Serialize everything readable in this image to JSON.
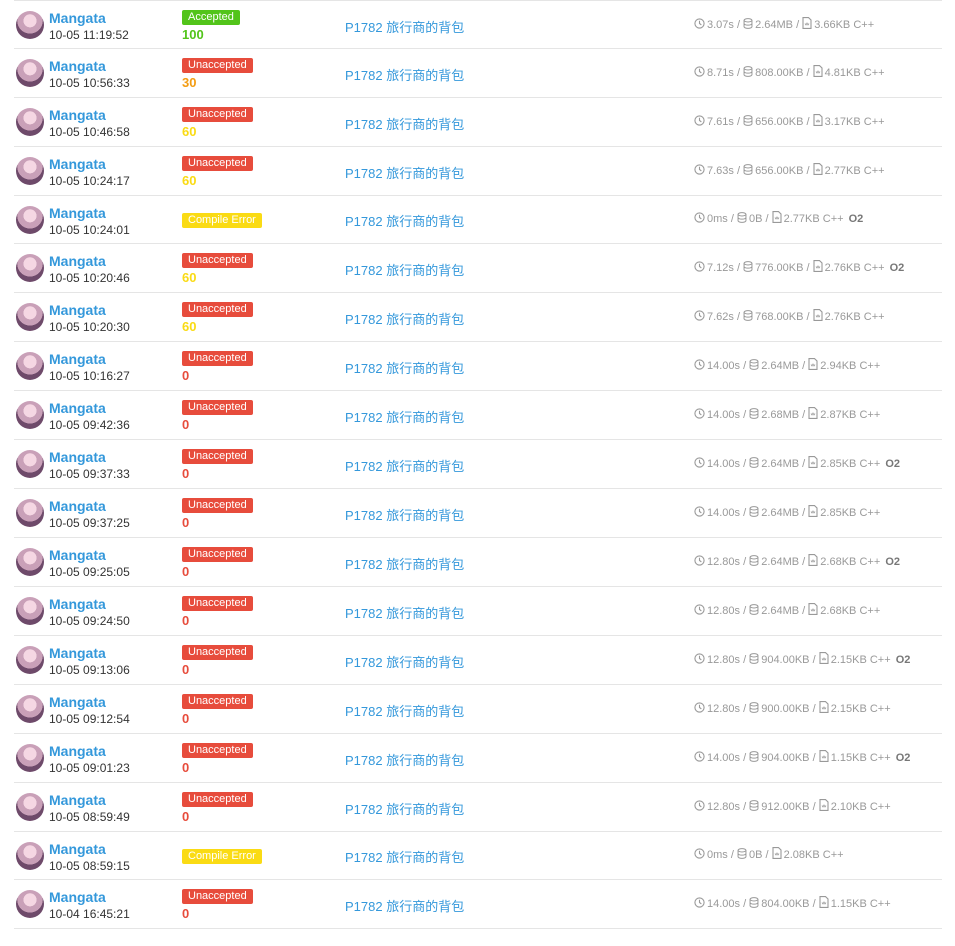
{
  "colors": {
    "accepted": "#52c41a",
    "unaccepted": "#e74c3c",
    "compile_error": "#fadb14",
    "link": "#3498db",
    "score_100": "#52c41a",
    "score_30": "#f39c12",
    "score_60": "#fadb14",
    "score_0": "#e74c3c"
  },
  "records": [
    {
      "user": "Mangata",
      "time": "10-05 11:19:52",
      "status": "Accepted",
      "score": "100",
      "problem": "P1782 旅行商的背包",
      "run_time": "3.07s",
      "memory": "2.64MB",
      "code_size": "3.66KB",
      "lang": "C++",
      "o2": ""
    },
    {
      "user": "Mangata",
      "time": "10-05 10:56:33",
      "status": "Unaccepted",
      "score": "30",
      "problem": "P1782 旅行商的背包",
      "run_time": "8.71s",
      "memory": "808.00KB",
      "code_size": "4.81KB",
      "lang": "C++",
      "o2": ""
    },
    {
      "user": "Mangata",
      "time": "10-05 10:46:58",
      "status": "Unaccepted",
      "score": "60",
      "problem": "P1782 旅行商的背包",
      "run_time": "7.61s",
      "memory": "656.00KB",
      "code_size": "3.17KB",
      "lang": "C++",
      "o2": ""
    },
    {
      "user": "Mangata",
      "time": "10-05 10:24:17",
      "status": "Unaccepted",
      "score": "60",
      "problem": "P1782 旅行商的背包",
      "run_time": "7.63s",
      "memory": "656.00KB",
      "code_size": "2.77KB",
      "lang": "C++",
      "o2": ""
    },
    {
      "user": "Mangata",
      "time": "10-05 10:24:01",
      "status": "Compile Error",
      "score": "",
      "problem": "P1782 旅行商的背包",
      "run_time": "0ms",
      "memory": "0B",
      "code_size": "2.77KB",
      "lang": "C++",
      "o2": "O2"
    },
    {
      "user": "Mangata",
      "time": "10-05 10:20:46",
      "status": "Unaccepted",
      "score": "60",
      "problem": "P1782 旅行商的背包",
      "run_time": "7.12s",
      "memory": "776.00KB",
      "code_size": "2.76KB",
      "lang": "C++",
      "o2": "O2"
    },
    {
      "user": "Mangata",
      "time": "10-05 10:20:30",
      "status": "Unaccepted",
      "score": "60",
      "problem": "P1782 旅行商的背包",
      "run_time": "7.62s",
      "memory": "768.00KB",
      "code_size": "2.76KB",
      "lang": "C++",
      "o2": ""
    },
    {
      "user": "Mangata",
      "time": "10-05 10:16:27",
      "status": "Unaccepted",
      "score": "0",
      "problem": "P1782 旅行商的背包",
      "run_time": "14.00s",
      "memory": "2.64MB",
      "code_size": "2.94KB",
      "lang": "C++",
      "o2": ""
    },
    {
      "user": "Mangata",
      "time": "10-05 09:42:36",
      "status": "Unaccepted",
      "score": "0",
      "problem": "P1782 旅行商的背包",
      "run_time": "14.00s",
      "memory": "2.68MB",
      "code_size": "2.87KB",
      "lang": "C++",
      "o2": ""
    },
    {
      "user": "Mangata",
      "time": "10-05 09:37:33",
      "status": "Unaccepted",
      "score": "0",
      "problem": "P1782 旅行商的背包",
      "run_time": "14.00s",
      "memory": "2.64MB",
      "code_size": "2.85KB",
      "lang": "C++",
      "o2": "O2"
    },
    {
      "user": "Mangata",
      "time": "10-05 09:37:25",
      "status": "Unaccepted",
      "score": "0",
      "problem": "P1782 旅行商的背包",
      "run_time": "14.00s",
      "memory": "2.64MB",
      "code_size": "2.85KB",
      "lang": "C++",
      "o2": ""
    },
    {
      "user": "Mangata",
      "time": "10-05 09:25:05",
      "status": "Unaccepted",
      "score": "0",
      "problem": "P1782 旅行商的背包",
      "run_time": "12.80s",
      "memory": "2.64MB",
      "code_size": "2.68KB",
      "lang": "C++",
      "o2": "O2"
    },
    {
      "user": "Mangata",
      "time": "10-05 09:24:50",
      "status": "Unaccepted",
      "score": "0",
      "problem": "P1782 旅行商的背包",
      "run_time": "12.80s",
      "memory": "2.64MB",
      "code_size": "2.68KB",
      "lang": "C++",
      "o2": ""
    },
    {
      "user": "Mangata",
      "time": "10-05 09:13:06",
      "status": "Unaccepted",
      "score": "0",
      "problem": "P1782 旅行商的背包",
      "run_time": "12.80s",
      "memory": "904.00KB",
      "code_size": "2.15KB",
      "lang": "C++",
      "o2": "O2"
    },
    {
      "user": "Mangata",
      "time": "10-05 09:12:54",
      "status": "Unaccepted",
      "score": "0",
      "problem": "P1782 旅行商的背包",
      "run_time": "12.80s",
      "memory": "900.00KB",
      "code_size": "2.15KB",
      "lang": "C++",
      "o2": ""
    },
    {
      "user": "Mangata",
      "time": "10-05 09:01:23",
      "status": "Unaccepted",
      "score": "0",
      "problem": "P1782 旅行商的背包",
      "run_time": "14.00s",
      "memory": "904.00KB",
      "code_size": "1.15KB",
      "lang": "C++",
      "o2": "O2"
    },
    {
      "user": "Mangata",
      "time": "10-05 08:59:49",
      "status": "Unaccepted",
      "score": "0",
      "problem": "P1782 旅行商的背包",
      "run_time": "12.80s",
      "memory": "912.00KB",
      "code_size": "2.10KB",
      "lang": "C++",
      "o2": ""
    },
    {
      "user": "Mangata",
      "time": "10-05 08:59:15",
      "status": "Compile Error",
      "score": "",
      "problem": "P1782 旅行商的背包",
      "run_time": "0ms",
      "memory": "0B",
      "code_size": "2.08KB",
      "lang": "C++",
      "o2": ""
    },
    {
      "user": "Mangata",
      "time": "10-04 16:45:21",
      "status": "Unaccepted",
      "score": "0",
      "problem": "P1782 旅行商的背包",
      "run_time": "14.00s",
      "memory": "804.00KB",
      "code_size": "1.15KB",
      "lang": "C++",
      "o2": ""
    }
  ]
}
